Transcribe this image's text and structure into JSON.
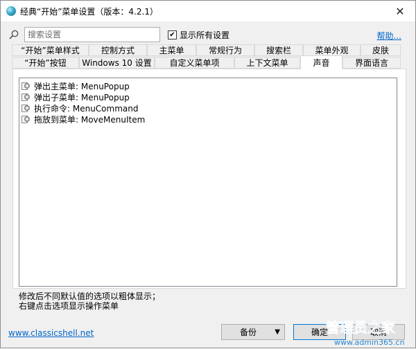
{
  "window": {
    "title": "经典“开始”菜单设置（版本：4.2.1）",
    "close_glyph": "✕"
  },
  "search": {
    "placeholder": "搜索设置",
    "value": ""
  },
  "show_all": {
    "label": "显示所有设置",
    "checked": true,
    "check_glyph": "✔"
  },
  "help": {
    "label": "帮助..."
  },
  "tabs_row1": [
    {
      "label": "“开始”菜单样式"
    },
    {
      "label": "控制方式"
    },
    {
      "label": "主菜单"
    },
    {
      "label": "常规行为"
    },
    {
      "label": "搜索栏"
    },
    {
      "label": "菜单外观"
    },
    {
      "label": "皮肤"
    }
  ],
  "tabs_row2": [
    {
      "label": "“开始”按钮"
    },
    {
      "label": "Windows 10 设置"
    },
    {
      "label": "自定义菜单项"
    },
    {
      "label": "上下文菜单"
    },
    {
      "label": "声音",
      "active": true
    },
    {
      "label": "界面语言"
    }
  ],
  "sound_list": [
    {
      "label": "弹出主菜单: MenuPopup"
    },
    {
      "label": "弹出子菜单: MenuPopup"
    },
    {
      "label": "执行命令: MenuCommand"
    },
    {
      "label": "拖放到菜单: MoveMenuItem"
    }
  ],
  "notes": {
    "line1": "修改后不同默认值的选项以粗体显示；",
    "line2": "右键点击选项显示操作菜单"
  },
  "footer": {
    "link": "www.classicshell.net",
    "backup_label": "备份",
    "ok_label": "确定",
    "cancel_label": "取消"
  },
  "watermark": {
    "brand": "管理员之家",
    "url": "www.admin365.cn"
  },
  "colors": {
    "link": "#0066cc",
    "watermark": "#2a86d0"
  }
}
